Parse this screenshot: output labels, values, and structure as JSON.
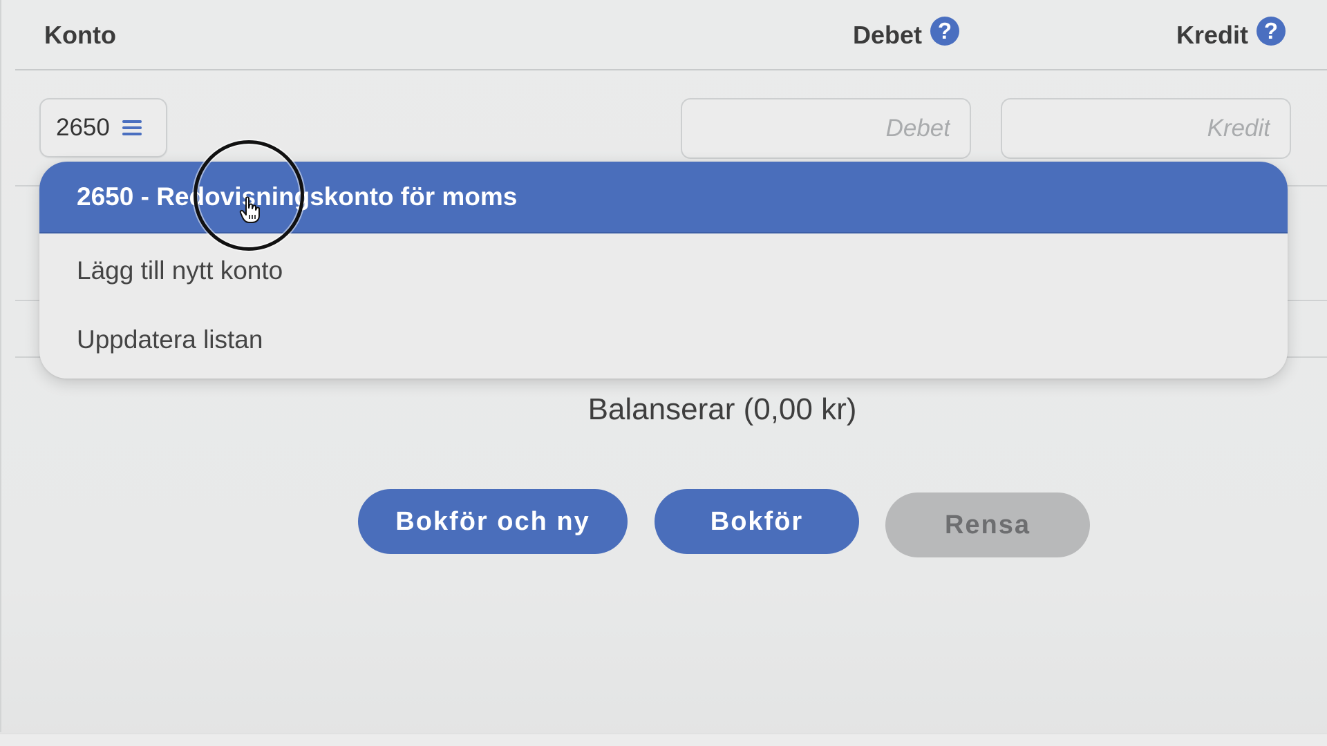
{
  "header": {
    "konto_label": "Konto",
    "debet_label": "Debet",
    "kredit_label": "Kredit",
    "help_glyph": "?"
  },
  "entry_row": {
    "account_value": "2650",
    "account_icon": "menu-icon",
    "debet_placeholder": "Debet",
    "kredit_placeholder": "Kredit"
  },
  "dropdown": {
    "selected": "2650 - Redovisningskonto för moms",
    "items": [
      "Lägg till nytt konto",
      "Uppdatera listan"
    ]
  },
  "balance": {
    "text": "Balanserar (0,00 kr)"
  },
  "actions": {
    "post_new": "Bokför och ny",
    "post": "Bokför",
    "clear": "Rensa"
  },
  "colors": {
    "accent": "#4a6ebb",
    "help": "#4a6fc0",
    "disabled": "#b8b9ba",
    "background": "#e9eaea"
  }
}
